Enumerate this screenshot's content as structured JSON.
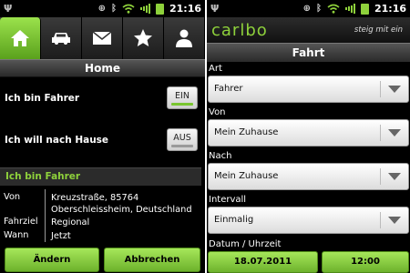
{
  "status": {
    "time": "21:16"
  },
  "left": {
    "tabs": [
      {
        "icon": "home-icon",
        "active": true
      },
      {
        "icon": "car-icon",
        "active": false
      },
      {
        "icon": "mail-icon",
        "active": false
      },
      {
        "icon": "star-icon",
        "active": false
      },
      {
        "icon": "user-icon",
        "active": false
      }
    ],
    "header": "Home",
    "toggle1": {
      "label": "Ich bin Fahrer",
      "value": "EIN"
    },
    "toggle2": {
      "label": "Ich will nach Hause",
      "value": "AUS"
    },
    "section": "Ich bin Fahrer",
    "info": {
      "von_key": "Von",
      "von_val": "Kreuzstraße, 85764 Oberschleissheim, Deutschland",
      "ziel_key": "Fahrziel",
      "ziel_val": "Regional",
      "wann_key": "Wann",
      "wann_val": "Jetzt"
    },
    "buttons": {
      "edit": "Ändern",
      "cancel": "Abbrechen"
    }
  },
  "right": {
    "logo": "carlbo",
    "slogan": "steig mit ein",
    "title": "Fahrt",
    "fields": [
      {
        "label": "Art",
        "value": "Fahrer"
      },
      {
        "label": "Von",
        "value": "Mein Zuhause"
      },
      {
        "label": "Nach",
        "value": "Mein Zuhause"
      },
      {
        "label": "Intervall",
        "value": "Einmalig"
      }
    ],
    "datetime_label": "Datum / Uhrzeit",
    "date": "18.07.2011",
    "time": "12:00"
  },
  "colors": {
    "accent": "#8ed13b"
  }
}
